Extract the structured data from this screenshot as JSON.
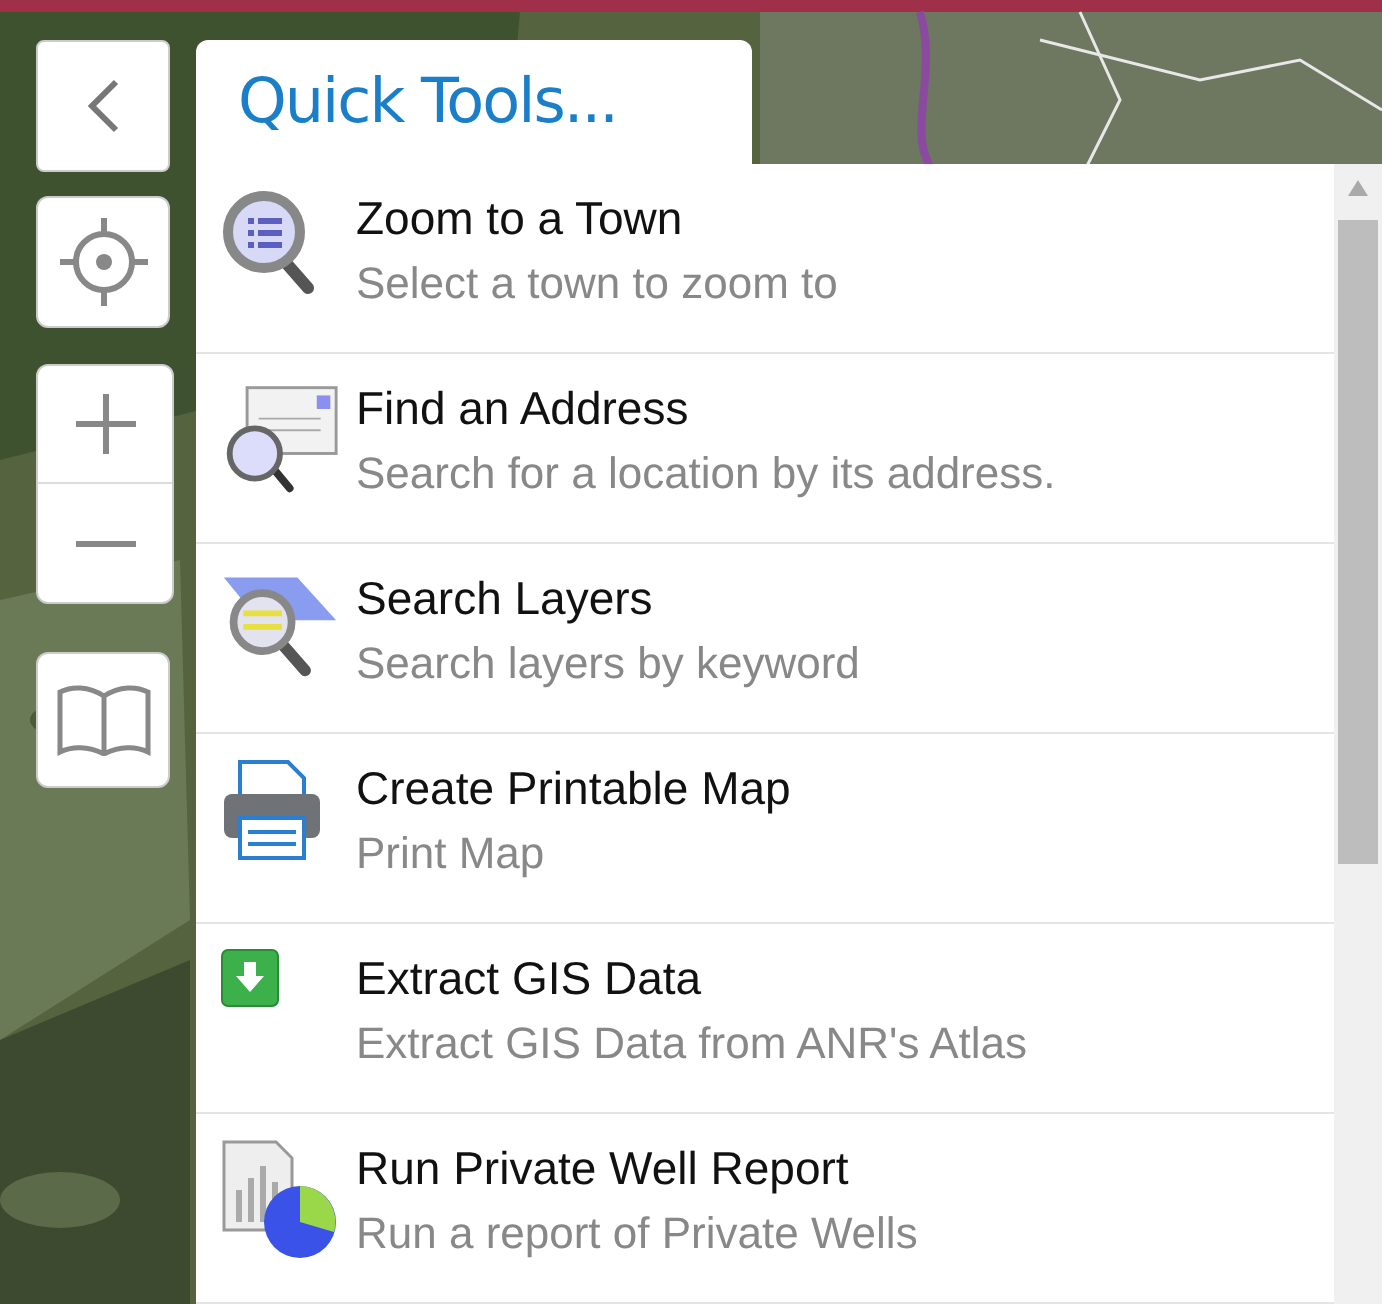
{
  "panel": {
    "title": "Quick Tools..."
  },
  "tools": [
    {
      "kind": "town",
      "title": "Zoom to a Town",
      "description": "Select a town to zoom to"
    },
    {
      "kind": "address",
      "title": "Find an Address",
      "description": "Search for a location by its address."
    },
    {
      "kind": "layers",
      "title": "Search Layers",
      "description": "Search layers by keyword"
    },
    {
      "kind": "print",
      "title": "Create Printable Map",
      "description": "Print Map"
    },
    {
      "kind": "download",
      "title": "Extract GIS Data",
      "description": "Extract GIS Data from ANR's Atlas"
    },
    {
      "kind": "report",
      "title": "Run Private Well Report",
      "description": "Run a report of Private Wells"
    }
  ]
}
